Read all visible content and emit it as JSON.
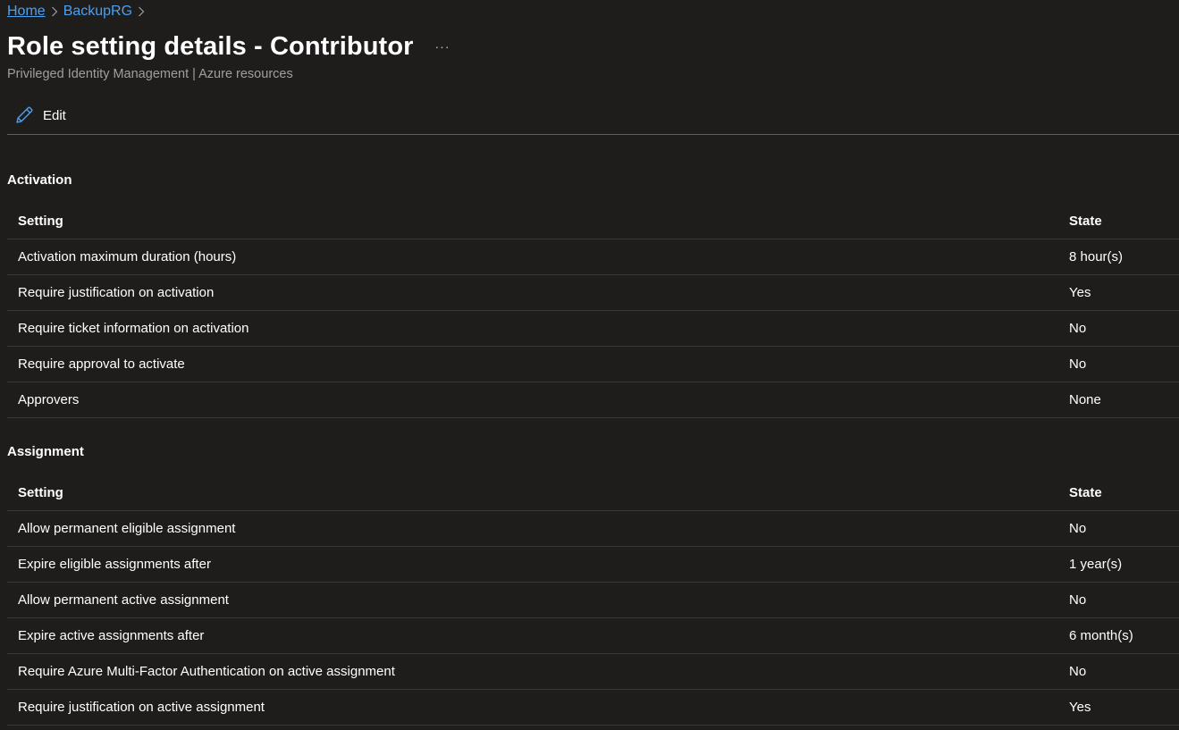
{
  "breadcrumb": {
    "items": [
      "Home",
      "BackupRG"
    ]
  },
  "page": {
    "title": "Role setting details - Contributor",
    "more_label": "···",
    "subtitle": "Privileged Identity Management | Azure resources"
  },
  "toolbar": {
    "edit_label": "Edit",
    "edit_icon": "pencil-icon"
  },
  "activation": {
    "title": "Activation",
    "columns": [
      "Setting",
      "State"
    ],
    "rows": [
      {
        "setting": "Activation maximum duration (hours)",
        "state": "8 hour(s)"
      },
      {
        "setting": "Require justification on activation",
        "state": "Yes"
      },
      {
        "setting": "Require ticket information on activation",
        "state": "No"
      },
      {
        "setting": "Require approval to activate",
        "state": "No"
      },
      {
        "setting": "Approvers",
        "state": "None"
      }
    ]
  },
  "assignment": {
    "title": "Assignment",
    "columns": [
      "Setting",
      "State"
    ],
    "rows": [
      {
        "setting": "Allow permanent eligible assignment",
        "state": "No"
      },
      {
        "setting": "Expire eligible assignments after",
        "state": "1 year(s)"
      },
      {
        "setting": "Allow permanent active assignment",
        "state": "No"
      },
      {
        "setting": "Expire active assignments after",
        "state": "6 month(s)"
      },
      {
        "setting": "Require Azure Multi-Factor Authentication on active assignment",
        "state": "No"
      },
      {
        "setting": "Require justification on active assignment",
        "state": "Yes"
      }
    ]
  },
  "colors": {
    "background": "#1f1d1c",
    "link": "#4ba0ef",
    "subtitle": "#a19f9d",
    "divider": "#3b3a39"
  }
}
